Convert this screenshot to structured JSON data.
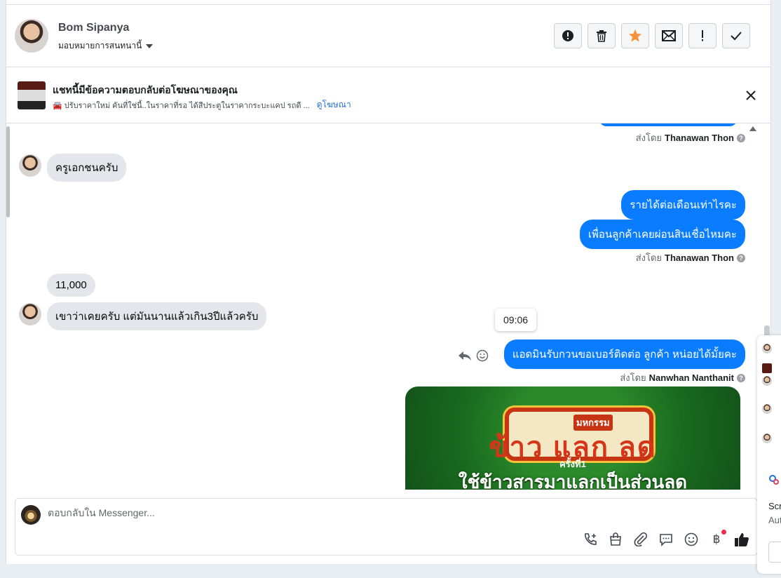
{
  "header": {
    "contact_name": "Bom Sipanya",
    "assign_label": "มอบหมายการสนทนานี้",
    "actions": [
      {
        "name": "spam-button",
        "icon": "alert-circle-icon"
      },
      {
        "name": "delete-button",
        "icon": "trash-icon"
      },
      {
        "name": "star-button",
        "icon": "star-icon"
      },
      {
        "name": "mark-unread-button",
        "icon": "envelope-icon"
      },
      {
        "name": "priority-button",
        "icon": "exclamation-icon"
      },
      {
        "name": "mark-done-button",
        "icon": "check-icon"
      }
    ],
    "star_color": "#f7923b"
  },
  "ad": {
    "title": "แชทนี้มีข้อความตอบกลับต่อโฆษณาของคุณ",
    "snippet": "🚘 ปรับราคาใหม่ คันที่ใช่นี้..ในราคาที่รอ ได้สีประตูในราคากระบะแคป รถดี ...",
    "link": "ดูโฆษณา"
  },
  "messages": {
    "sent_by_prefix": "ส่งโดย",
    "agent1": "Thanawan Thon",
    "agent2": "Nanwhan Nanthanit",
    "in_1": "ครูเอกชนครับ",
    "out_1": "รายได้ต่อเดือนเท่าไรคะ",
    "out_2": "เพื่อนลูกค้าเคยผ่อนสินเชื่อไหมคะ",
    "in_2": "11,000",
    "in_3": "เขาว่าเคยครับ แต่มันนานแล้วเกิน3ปีแล้วครับ",
    "tooltip_time": "09:06",
    "out_3": "แอดมินรับกวนขอเบอร์ติดต่อ ลูกค้า  หน่อยได้มั้ยคะ"
  },
  "promo": {
    "small": "มหกรรม",
    "big": "ข้าว แลก ลด",
    "round": "ครั้งที่1",
    "sub": "ใช้ข้าวสารมาแลกเป็นส่วนลด"
  },
  "composer": {
    "placeholder": "ตอบกลับใน Messenger..."
  },
  "edge": {
    "text1": "Scr",
    "text2": "Aut"
  },
  "colors": {
    "bubble_out": "#0a7cff",
    "bubble_in": "#e4e6eb",
    "link": "#216fdb"
  }
}
